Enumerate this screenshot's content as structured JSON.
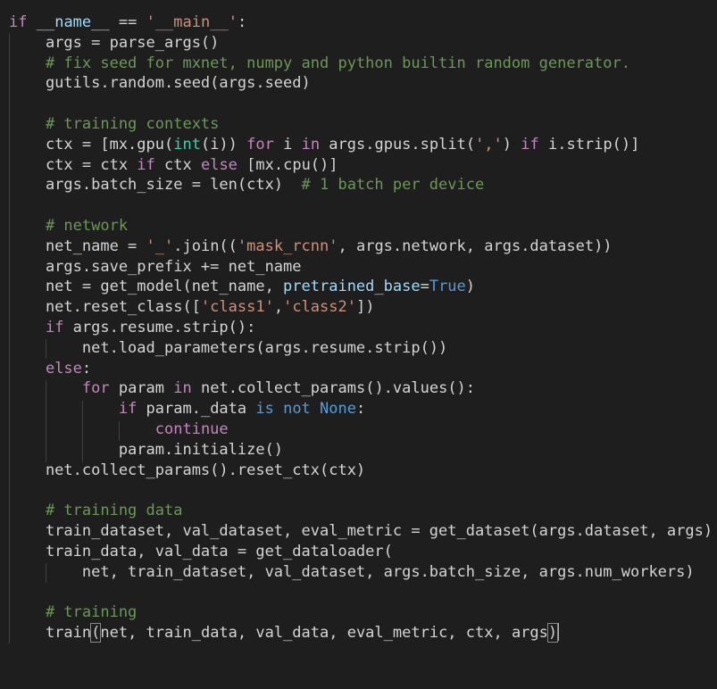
{
  "editor": {
    "language": "python",
    "background": "#1e1e1e",
    "colors": {
      "keyword": "#c586c0",
      "constant": "#569cd6",
      "string": "#ce9178",
      "comment": "#6a9955",
      "builtin": "#4ec9b0",
      "parameter": "#9cdcfe",
      "text": "#d4d4d4"
    },
    "lines": {
      "l1": [
        [
          "kw",
          "if"
        ],
        [
          "fn",
          " "
        ],
        [
          "dunder",
          "__name__"
        ],
        [
          "fn",
          " == "
        ],
        [
          "str",
          "'__main__'"
        ],
        [
          "fn",
          ":"
        ]
      ],
      "l2": [
        [
          "fn",
          "    args = parse_args()"
        ]
      ],
      "l3": [
        [
          "cmt",
          "    # fix seed for mxnet, numpy and python builtin random generator."
        ]
      ],
      "l4": [
        [
          "fn",
          "    gutils.random.seed(args.seed)"
        ]
      ],
      "l5": [
        [
          "fn",
          ""
        ]
      ],
      "l6": [
        [
          "cmt",
          "    # training contexts"
        ]
      ],
      "l7": [
        [
          "fn",
          "    ctx = [mx.gpu("
        ],
        [
          "bi",
          "int"
        ],
        [
          "fn",
          "(i)) "
        ],
        [
          "kw",
          "for"
        ],
        [
          "fn",
          " i "
        ],
        [
          "kw",
          "in"
        ],
        [
          "fn",
          " args.gpus.split("
        ],
        [
          "str",
          "','"
        ],
        [
          "fn",
          ") "
        ],
        [
          "kw",
          "if"
        ],
        [
          "fn",
          " i.strip()]"
        ]
      ],
      "l8": [
        [
          "fn",
          "    ctx = ctx "
        ],
        [
          "kw",
          "if"
        ],
        [
          "fn",
          " ctx "
        ],
        [
          "kw",
          "else"
        ],
        [
          "fn",
          " [mx.cpu()]"
        ]
      ],
      "l9": [
        [
          "fn",
          "    args.batch_size = len(ctx)  "
        ],
        [
          "cmt",
          "# 1 batch per device"
        ]
      ],
      "l10": [
        [
          "fn",
          ""
        ]
      ],
      "l11": [
        [
          "cmt",
          "    # network"
        ]
      ],
      "l12": [
        [
          "fn",
          "    net_name = "
        ],
        [
          "str",
          "'_'"
        ],
        [
          "fn",
          ".join(("
        ],
        [
          "str",
          "'mask_rcnn'"
        ],
        [
          "fn",
          ", args.network, args.dataset))"
        ]
      ],
      "l13": [
        [
          "fn",
          "    args.save_prefix += net_name"
        ]
      ],
      "l14": [
        [
          "fn",
          "    net = get_model(net_name, "
        ],
        [
          "prm",
          "pretrained_base"
        ],
        [
          "fn",
          "="
        ],
        [
          "kw2",
          "True"
        ],
        [
          "fn",
          ")"
        ]
      ],
      "l15": [
        [
          "fn",
          "    net.reset_class(["
        ],
        [
          "str",
          "'class1'"
        ],
        [
          "fn",
          ","
        ],
        [
          "str",
          "'class2'"
        ],
        [
          "fn",
          "])"
        ]
      ],
      "l16": [
        [
          "fn",
          "    "
        ],
        [
          "kw",
          "if"
        ],
        [
          "fn",
          " args.resume.strip():"
        ]
      ],
      "l17": [
        [
          "fn",
          "        net.load_parameters(args.resume.strip())"
        ]
      ],
      "l18": [
        [
          "fn",
          "    "
        ],
        [
          "kw",
          "else"
        ],
        [
          "fn",
          ":"
        ]
      ],
      "l19": [
        [
          "fn",
          "        "
        ],
        [
          "kw",
          "for"
        ],
        [
          "fn",
          " param "
        ],
        [
          "kw",
          "in"
        ],
        [
          "fn",
          " net.collect_params().values():"
        ]
      ],
      "l20": [
        [
          "fn",
          "            "
        ],
        [
          "kw",
          "if"
        ],
        [
          "fn",
          " param._data "
        ],
        [
          "kw2",
          "is not None"
        ],
        [
          "fn",
          ":"
        ]
      ],
      "l21": [
        [
          "fn",
          "                "
        ],
        [
          "kw",
          "continue"
        ]
      ],
      "l22": [
        [
          "fn",
          "            param.initialize()"
        ]
      ],
      "l23": [
        [
          "fn",
          "    net.collect_params().reset_ctx(ctx)"
        ]
      ],
      "l24": [
        [
          "fn",
          ""
        ]
      ],
      "l25": [
        [
          "cmt",
          "    # training data"
        ]
      ],
      "l26": [
        [
          "fn",
          "    train_dataset, val_dataset, eval_metric = get_dataset(args.dataset, args)"
        ]
      ],
      "l27": [
        [
          "fn",
          "    train_data, val_data = get_dataloader("
        ]
      ],
      "l28": [
        [
          "fn",
          "        net, train_dataset, val_dataset, args.batch_size, args.num_workers)"
        ]
      ],
      "l29": [
        [
          "fn",
          ""
        ]
      ],
      "l30": [
        [
          "cmt",
          "    # training"
        ]
      ],
      "l31": [
        [
          "fn",
          "    train"
        ],
        [
          "cur",
          "("
        ],
        [
          "fn",
          "net, train_data, val_data, eval_metric, ctx, args"
        ],
        [
          "cur",
          ")"
        ],
        [
          "caret",
          ""
        ]
      ]
    }
  }
}
